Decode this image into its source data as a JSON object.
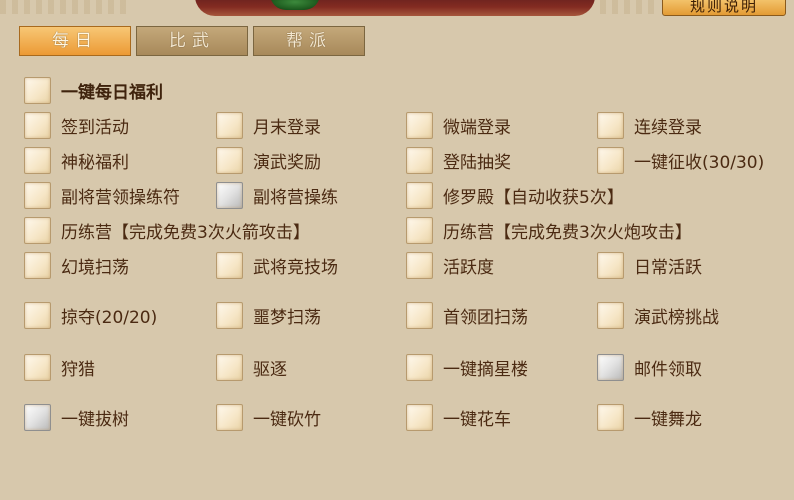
{
  "header": {
    "rules_button": "规则说明"
  },
  "tabs": [
    {
      "label": "每日",
      "active": true
    },
    {
      "label": "比武",
      "active": false
    },
    {
      "label": "帮派",
      "active": false
    }
  ],
  "options": {
    "all_daily": "一键每日福利",
    "r1": [
      "签到活动",
      "月末登录",
      "微端登录",
      "连续登录"
    ],
    "r2": [
      "神秘福利",
      "演武奖励",
      "登陆抽奖",
      "一键征收(30/30)"
    ],
    "r3": [
      "副将营领操练符",
      "副将营操练",
      "修罗殿【自动收获5次】"
    ],
    "r4": [
      "历练营【完成免费3次火箭攻击】",
      "历练营【完成免费3次火炮攻击】"
    ],
    "r5": [
      "幻境扫荡",
      "武将竞技场",
      "活跃度",
      "日常活跃"
    ],
    "r6": [
      "掠夺(20/20)",
      "噩梦扫荡",
      "首领团扫荡",
      "演武榜挑战"
    ],
    "r7": [
      "狩猎",
      "驱逐",
      "一键摘星楼",
      "邮件领取"
    ],
    "r8": [
      "一键拔树",
      "一键砍竹",
      "一键花车",
      "一键舞龙"
    ]
  },
  "colors": {
    "background": "#d7c8ac",
    "text": "#4b2a12",
    "active_tab": "#ec9a35",
    "inactive_tab": "#a8895a"
  }
}
